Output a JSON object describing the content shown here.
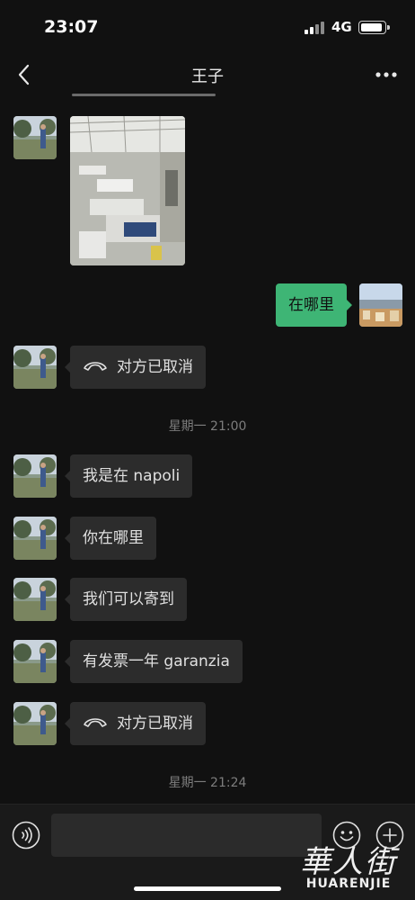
{
  "status_bar": {
    "time": "23:07",
    "network": "4G"
  },
  "nav": {
    "title": "王子",
    "back_icon": "chevron-left-icon",
    "more_icon": "ellipsis-icon"
  },
  "messages": [
    {
      "type": "image",
      "from": "contact"
    },
    {
      "type": "text",
      "from": "me",
      "text": "在哪里"
    },
    {
      "type": "call",
      "from": "contact",
      "text": "对方已取消"
    },
    {
      "type": "time",
      "text": "星期一 21:00"
    },
    {
      "type": "text",
      "from": "contact",
      "text": "我是在 napoli"
    },
    {
      "type": "text",
      "from": "contact",
      "text": "你在哪里"
    },
    {
      "type": "text",
      "from": "contact",
      "text": "我们可以寄到"
    },
    {
      "type": "text",
      "from": "contact",
      "text": "有发票一年 garanzia"
    },
    {
      "type": "call",
      "from": "contact",
      "text": "对方已取消"
    },
    {
      "type": "time",
      "text": "星期一 21:24"
    }
  ],
  "input_bar": {
    "value": "",
    "voice_icon": "voice-icon",
    "emoji_icon": "emoji-icon",
    "plus_icon": "plus-icon"
  },
  "watermark": {
    "cn": "華人街",
    "en": "HUARENJIE"
  },
  "colors": {
    "background": "#111111",
    "bubble_in": "#2c2c2c",
    "bubble_out": "#3eb575",
    "timestamp": "#7d7d7d"
  }
}
